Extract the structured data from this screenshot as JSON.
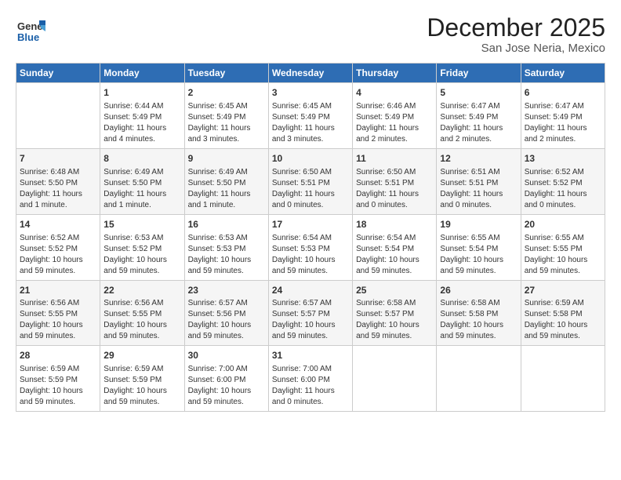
{
  "header": {
    "logo_general": "General",
    "logo_blue": "Blue",
    "title": "December 2025",
    "subtitle": "San Jose Neria, Mexico"
  },
  "calendar": {
    "days_of_week": [
      "Sunday",
      "Monday",
      "Tuesday",
      "Wednesday",
      "Thursday",
      "Friday",
      "Saturday"
    ],
    "weeks": [
      [
        {
          "day": "",
          "content": ""
        },
        {
          "day": "1",
          "content": "Sunrise: 6:44 AM\nSunset: 5:49 PM\nDaylight: 11 hours\nand 4 minutes."
        },
        {
          "day": "2",
          "content": "Sunrise: 6:45 AM\nSunset: 5:49 PM\nDaylight: 11 hours\nand 3 minutes."
        },
        {
          "day": "3",
          "content": "Sunrise: 6:45 AM\nSunset: 5:49 PM\nDaylight: 11 hours\nand 3 minutes."
        },
        {
          "day": "4",
          "content": "Sunrise: 6:46 AM\nSunset: 5:49 PM\nDaylight: 11 hours\nand 2 minutes."
        },
        {
          "day": "5",
          "content": "Sunrise: 6:47 AM\nSunset: 5:49 PM\nDaylight: 11 hours\nand 2 minutes."
        },
        {
          "day": "6",
          "content": "Sunrise: 6:47 AM\nSunset: 5:49 PM\nDaylight: 11 hours\nand 2 minutes."
        }
      ],
      [
        {
          "day": "7",
          "content": "Sunrise: 6:48 AM\nSunset: 5:50 PM\nDaylight: 11 hours\nand 1 minute."
        },
        {
          "day": "8",
          "content": "Sunrise: 6:49 AM\nSunset: 5:50 PM\nDaylight: 11 hours\nand 1 minute."
        },
        {
          "day": "9",
          "content": "Sunrise: 6:49 AM\nSunset: 5:50 PM\nDaylight: 11 hours\nand 1 minute."
        },
        {
          "day": "10",
          "content": "Sunrise: 6:50 AM\nSunset: 5:51 PM\nDaylight: 11 hours\nand 0 minutes."
        },
        {
          "day": "11",
          "content": "Sunrise: 6:50 AM\nSunset: 5:51 PM\nDaylight: 11 hours\nand 0 minutes."
        },
        {
          "day": "12",
          "content": "Sunrise: 6:51 AM\nSunset: 5:51 PM\nDaylight: 11 hours\nand 0 minutes."
        },
        {
          "day": "13",
          "content": "Sunrise: 6:52 AM\nSunset: 5:52 PM\nDaylight: 11 hours\nand 0 minutes."
        }
      ],
      [
        {
          "day": "14",
          "content": "Sunrise: 6:52 AM\nSunset: 5:52 PM\nDaylight: 10 hours\nand 59 minutes."
        },
        {
          "day": "15",
          "content": "Sunrise: 6:53 AM\nSunset: 5:52 PM\nDaylight: 10 hours\nand 59 minutes."
        },
        {
          "day": "16",
          "content": "Sunrise: 6:53 AM\nSunset: 5:53 PM\nDaylight: 10 hours\nand 59 minutes."
        },
        {
          "day": "17",
          "content": "Sunrise: 6:54 AM\nSunset: 5:53 PM\nDaylight: 10 hours\nand 59 minutes."
        },
        {
          "day": "18",
          "content": "Sunrise: 6:54 AM\nSunset: 5:54 PM\nDaylight: 10 hours\nand 59 minutes."
        },
        {
          "day": "19",
          "content": "Sunrise: 6:55 AM\nSunset: 5:54 PM\nDaylight: 10 hours\nand 59 minutes."
        },
        {
          "day": "20",
          "content": "Sunrise: 6:55 AM\nSunset: 5:55 PM\nDaylight: 10 hours\nand 59 minutes."
        }
      ],
      [
        {
          "day": "21",
          "content": "Sunrise: 6:56 AM\nSunset: 5:55 PM\nDaylight: 10 hours\nand 59 minutes."
        },
        {
          "day": "22",
          "content": "Sunrise: 6:56 AM\nSunset: 5:55 PM\nDaylight: 10 hours\nand 59 minutes."
        },
        {
          "day": "23",
          "content": "Sunrise: 6:57 AM\nSunset: 5:56 PM\nDaylight: 10 hours\nand 59 minutes."
        },
        {
          "day": "24",
          "content": "Sunrise: 6:57 AM\nSunset: 5:57 PM\nDaylight: 10 hours\nand 59 minutes."
        },
        {
          "day": "25",
          "content": "Sunrise: 6:58 AM\nSunset: 5:57 PM\nDaylight: 10 hours\nand 59 minutes."
        },
        {
          "day": "26",
          "content": "Sunrise: 6:58 AM\nSunset: 5:58 PM\nDaylight: 10 hours\nand 59 minutes."
        },
        {
          "day": "27",
          "content": "Sunrise: 6:59 AM\nSunset: 5:58 PM\nDaylight: 10 hours\nand 59 minutes."
        }
      ],
      [
        {
          "day": "28",
          "content": "Sunrise: 6:59 AM\nSunset: 5:59 PM\nDaylight: 10 hours\nand 59 minutes."
        },
        {
          "day": "29",
          "content": "Sunrise: 6:59 AM\nSunset: 5:59 PM\nDaylight: 10 hours\nand 59 minutes."
        },
        {
          "day": "30",
          "content": "Sunrise: 7:00 AM\nSunset: 6:00 PM\nDaylight: 10 hours\nand 59 minutes."
        },
        {
          "day": "31",
          "content": "Sunrise: 7:00 AM\nSunset: 6:00 PM\nDaylight: 11 hours\nand 0 minutes."
        },
        {
          "day": "",
          "content": ""
        },
        {
          "day": "",
          "content": ""
        },
        {
          "day": "",
          "content": ""
        }
      ]
    ]
  }
}
